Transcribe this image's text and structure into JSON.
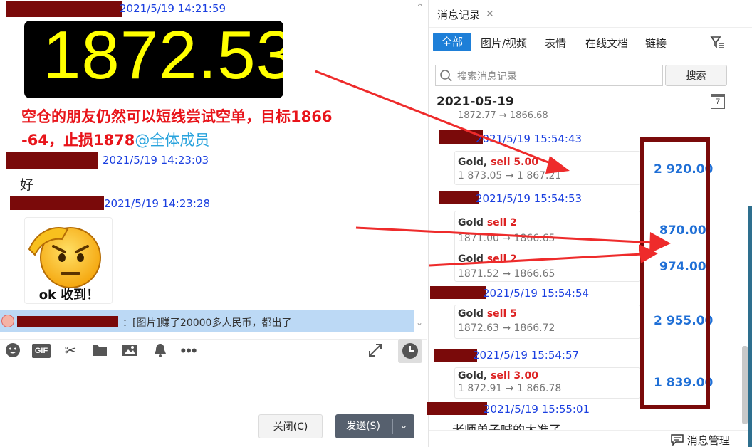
{
  "chat": {
    "messages": [
      {
        "timestamp": "2021/5/19 14:21:59"
      },
      {
        "timestamp": "2021/5/19 14:23:03",
        "text": "好"
      },
      {
        "timestamp": "2021/5/19 14:23:28",
        "sticker_text": "ok 收到！"
      }
    ],
    "price_display": "1872.53",
    "advice_line1": "空仓的朋友仍然可以短线尝试空单，目标1866",
    "advice_line2": "-64，止损1878",
    "mention": "@全体成员",
    "notice_bar": "：[图片]赚了20000多人民币，都出了"
  },
  "composer": {
    "toolbar_icons": [
      "emoji-icon",
      "gif-icon",
      "scissors-icon",
      "folder-icon",
      "image-icon",
      "bell-icon",
      "more-icon"
    ],
    "gif_label": "GIF",
    "close_button": "关闭(C)",
    "send_button": "发送(S)"
  },
  "history": {
    "tab_title": "消息记录",
    "filters": [
      "全部",
      "图片/视频",
      "表情",
      "在线文档",
      "链接"
    ],
    "active_filter": "全部",
    "search_placeholder": "搜索消息记录",
    "search_button": "搜索",
    "date_header": "2021-05-19",
    "calendar_day": "7",
    "first_line_partial": "1872.77 → 1866.68",
    "entries": [
      {
        "timestamp": "2021/5/19 15:54:43"
      },
      {
        "timestamp": "2021/5/19 15:54:53"
      },
      {
        "timestamp": "2021/5/19 15:54:54"
      },
      {
        "timestamp": "2021/5/19 15:54:57"
      },
      {
        "timestamp": "2021/5/19 15:55:01",
        "text": "老师单子喊的太准了"
      }
    ],
    "trades": [
      {
        "asset": "Gold,",
        "action": "sell 5.00",
        "prices": "1 873.05 → 1 867.21",
        "profit": "2 920.00"
      },
      {
        "asset": "Gold",
        "action": "sell 2",
        "prices": "1871.00 → 1866.65",
        "profit": "870.00"
      },
      {
        "asset": "Gold",
        "action": "sell 2",
        "prices": "1871.52 → 1866.65",
        "profit": "974.00"
      },
      {
        "asset": "Gold",
        "action": "sell 5",
        "prices": "1872.63 → 1866.72",
        "profit": "2 955.00"
      },
      {
        "asset": "Gold,",
        "action": "sell 3.00",
        "prices": "1 872.91 → 1 866.78",
        "profit": "1 839.00"
      }
    ],
    "manage_label": "消息管理"
  },
  "colors": {
    "accent_blue": "#1f6fd6",
    "red_text": "#e8141a",
    "redaction": "#7a0a0a",
    "arrow_red": "#ee2b2b"
  }
}
